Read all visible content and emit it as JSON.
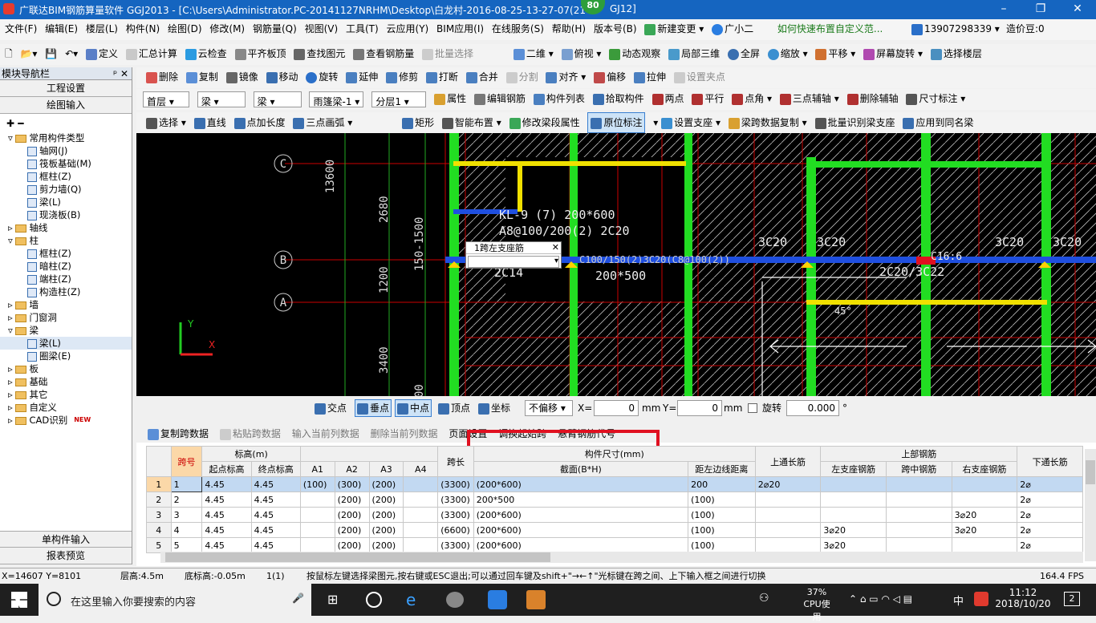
{
  "window": {
    "title": "广联达BIM钢筋算量软件 GGJ2013 - [C:\\Users\\Administrator.PC-20141127NRHM\\Desktop\\白龙村-2016-08-25-13-27-07(21",
    "title_tail": "GJ12]",
    "badge": "80",
    "minimize": "–",
    "restore": "❐",
    "close": "✕"
  },
  "menu": [
    "文件(F)",
    "编辑(E)",
    "楼层(L)",
    "构件(N)",
    "绘图(D)",
    "修改(M)",
    "钢筋量(Q)",
    "视图(V)",
    "工具(T)",
    "云应用(Y)",
    "BIM应用(I)",
    "在线服务(S)",
    "帮助(H)",
    "版本号(B)",
    "新建变更",
    "广小二",
    "如何快速布置自定义范..."
  ],
  "account": {
    "phone": "13907298339",
    "price_bean": "造价豆:0"
  },
  "toolbar1": [
    "定义",
    "汇总计算",
    "云检查",
    "平齐板顶",
    "查找图元",
    "查看钢筋量",
    "批量选择",
    "二维",
    "俯视",
    "动态观察",
    "局部三维",
    "全屏",
    "缩放",
    "平移",
    "屏幕旋转",
    "选择楼层"
  ],
  "toolbar2": [
    "删除",
    "复制",
    "镜像",
    "移动",
    "旋转",
    "延伸",
    "修剪",
    "打断",
    "合并",
    "分割",
    "对齐",
    "偏移",
    "拉伸",
    "设置夹点"
  ],
  "toolbar3": {
    "floor": "首层",
    "type": "梁",
    "sub": "梁",
    "component": "雨篷梁-1",
    "layer": "分层1",
    "items": [
      "属性",
      "编辑钢筋",
      "构件列表",
      "拾取构件",
      "两点",
      "平行",
      "点角",
      "三点辅轴",
      "删除辅轴",
      "尺寸标注"
    ]
  },
  "toolbar4": [
    "选择",
    "直线",
    "点加长度",
    "三点画弧",
    "矩形",
    "智能布置",
    "修改梁段属性",
    "原位标注",
    "设置支座",
    "梁跨数据复制",
    "批量识别梁支座",
    "应用到同名梁"
  ],
  "nav": {
    "title": "模块导航栏",
    "btn_project": "工程设置",
    "btn_draw": "绘图输入",
    "btn_single": "单构件输入",
    "btn_report": "报表预览",
    "tree": [
      {
        "label": "常用构件类型",
        "level": 0,
        "folder": true
      },
      {
        "label": "轴网(J)",
        "level": 1
      },
      {
        "label": "筏板基础(M)",
        "level": 1
      },
      {
        "label": "框柱(Z)",
        "level": 1
      },
      {
        "label": "剪力墙(Q)",
        "level": 1
      },
      {
        "label": "梁(L)",
        "level": 1
      },
      {
        "label": "现浇板(B)",
        "level": 1
      },
      {
        "label": "轴线",
        "level": 0,
        "folder": true
      },
      {
        "label": "柱",
        "level": 0,
        "folder": true
      },
      {
        "label": "框柱(Z)",
        "level": 1
      },
      {
        "label": "暗柱(Z)",
        "level": 1
      },
      {
        "label": "端柱(Z)",
        "level": 1
      },
      {
        "label": "构造柱(Z)",
        "level": 1
      },
      {
        "label": "墙",
        "level": 0,
        "folder": true
      },
      {
        "label": "门窗洞",
        "level": 0,
        "folder": true
      },
      {
        "label": "梁",
        "level": 0,
        "folder": true
      },
      {
        "label": "梁(L)",
        "level": 1
      },
      {
        "label": "圈梁(E)",
        "level": 1
      },
      {
        "label": "板",
        "level": 0,
        "folder": true
      },
      {
        "label": "基础",
        "level": 0,
        "folder": true
      },
      {
        "label": "其它",
        "level": 0,
        "folder": true
      },
      {
        "label": "自定义",
        "level": 0,
        "folder": true
      },
      {
        "label": "CAD识别",
        "level": 0,
        "folder": true,
        "new": "NEW"
      }
    ]
  },
  "canvas": {
    "axis_c": "C",
    "axis_b": "B",
    "axis_a": "A",
    "dim_13600": "13600",
    "dim_2680": "2680",
    "dim_150": "150-1500",
    "dim_1200": "1200",
    "dim_3400": "3400",
    "dim_00": "00",
    "kl": "KL-9 (7) 200*600",
    "a8": "A8@100/200(2) 2C20",
    "t2014": "2C14",
    "t200_500": "200*500",
    "g4c": "G4C12",
    "t3c20a": "3C20",
    "t3c20b": "3C20",
    "t3c20c": "3C20",
    "t3c20d": "3C20",
    "t2c20": "2C20/3C22",
    "t16": "C16:6",
    "t45": "45°",
    "rebar_row": "C100/150(2)3C20(C8@100(2))",
    "popup_title": "1跨左支座筋",
    "y": "Y",
    "x": "X"
  },
  "snap": {
    "items": [
      "交点",
      "垂点",
      "中点",
      "顶点",
      "坐标"
    ],
    "offset": "不偏移",
    "x_label": "X=",
    "x_val": "0",
    "mm": "mm",
    "y_label": "Y=",
    "y_val": "0",
    "rotate": "旋转",
    "rot_val": "0.000",
    "deg": "°"
  },
  "grid": {
    "tools": [
      "复制跨数据",
      "粘贴跨数据",
      "输入当前列数据",
      "删除当前列数据",
      "页面设置",
      "调换起始跨",
      "悬臂钢筋代号"
    ],
    "h_span": "跨号",
    "h_elev": "标高(m)",
    "h_start": "起点标高",
    "h_end": "终点标高",
    "h_a1": "A1",
    "h_a2": "A2",
    "h_a3": "A3",
    "h_a4": "A4",
    "h_len": "跨长",
    "h_size": "构件尺寸(mm)",
    "h_sec": "截面(B*H)",
    "h_dist": "距左边线距离",
    "h_top": "上通长筋",
    "h_upper": "上部钢筋",
    "h_left": "左支座钢筋",
    "h_mid": "跨中钢筋",
    "h_right": "右支座钢筋",
    "h_bot": "下通长筋",
    "rows": [
      {
        "n": "1",
        "span": "1",
        "s": "4.45",
        "e": "4.45",
        "a1": "(100)",
        "a2": "(300)",
        "a3": "(200)",
        "a4": "",
        "len": "(3300)",
        "sec": "(200*600)",
        "dist": "200",
        "top": "2⌀20",
        "left": "",
        "mid": "",
        "right": "",
        "bot": "2⌀"
      },
      {
        "n": "2",
        "span": "2",
        "s": "4.45",
        "e": "4.45",
        "a1": "",
        "a2": "(200)",
        "a3": "(200)",
        "a4": "",
        "len": "(3300)",
        "sec": "200*500",
        "dist": "(100)",
        "top": "",
        "left": "",
        "mid": "",
        "right": "",
        "bot": "2⌀"
      },
      {
        "n": "3",
        "span": "3",
        "s": "4.45",
        "e": "4.45",
        "a1": "",
        "a2": "(200)",
        "a3": "(200)",
        "a4": "",
        "len": "(3300)",
        "sec": "(200*600)",
        "dist": "(100)",
        "top": "",
        "left": "",
        "mid": "",
        "right": "3⌀20",
        "bot": "2⌀"
      },
      {
        "n": "4",
        "span": "4",
        "s": "4.45",
        "e": "4.45",
        "a1": "",
        "a2": "(200)",
        "a3": "(200)",
        "a4": "",
        "len": "(6600)",
        "sec": "(200*600)",
        "dist": "(100)",
        "top": "",
        "left": "3⌀20",
        "mid": "",
        "right": "3⌀20",
        "bot": "2⌀"
      },
      {
        "n": "5",
        "span": "5",
        "s": "4.45",
        "e": "4.45",
        "a1": "",
        "a2": "(200)",
        "a3": "(200)",
        "a4": "",
        "len": "(3300)",
        "sec": "(200*600)",
        "dist": "(100)",
        "top": "",
        "left": "3⌀20",
        "mid": "",
        "right": "",
        "bot": "2⌀"
      }
    ]
  },
  "status": {
    "coords": "X=14607 Y=8101",
    "floor_h": "层高:4.5m",
    "base": "底标高:-0.05m",
    "count": "1(1)",
    "hint": "按鼠标左键选择梁图元,按右键或ESC退出;可以通过回车键及shift+\"→←↑\"光标键在跨之间、上下输入框之间进行切换",
    "fps": "164.4 FPS"
  },
  "taskbar": {
    "search": "在这里输入你要搜索的内容",
    "cpu_pct": "37%",
    "cpu_label": "CPU使用",
    "ime": "中",
    "time": "11:12",
    "date": "2018/10/20",
    "notif": "2"
  },
  "colors": {
    "title": "#1565c0",
    "highlight": "#e01020",
    "column": "#22dd22",
    "beam": "#f0e000",
    "axis": "#cc0000"
  }
}
